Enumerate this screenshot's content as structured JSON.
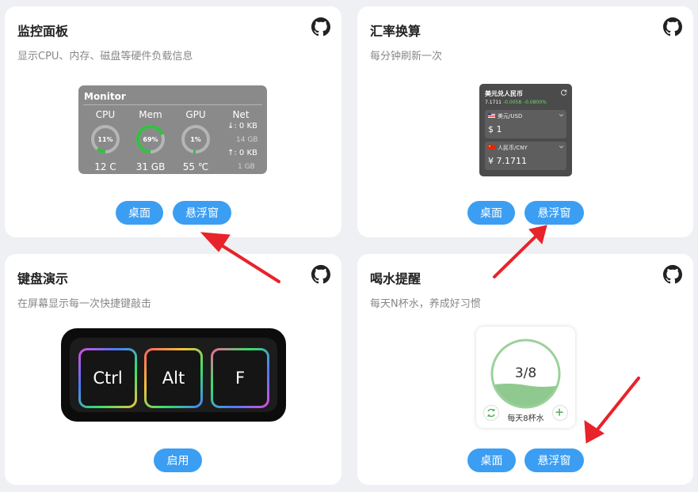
{
  "cards": {
    "monitor": {
      "title": "监控面板",
      "desc": "显示CPU、内存、磁盘等硬件负载信息",
      "widget": {
        "title": "Monitor",
        "cpu_label": "CPU",
        "cpu_pct": "11%",
        "cpu_val": "12 C",
        "cpu_level": 0.11,
        "mem_label": "Mem",
        "mem_pct": "69%",
        "mem_val": "31 GB",
        "mem_level": 0.69,
        "gpu_label": "GPU",
        "gpu_pct": "1%",
        "gpu_val": "55 ℃",
        "gpu_level": 0.01,
        "net_label": "Net",
        "net_down": "↓: 0 KB",
        "net_down_total": "14 GB",
        "net_up": "↑: 0 KB",
        "net_up_total": "1 GB"
      },
      "btn_desktop": "桌面",
      "btn_float": "悬浮窗"
    },
    "exchange": {
      "title": "汇率换算",
      "desc": "每分钟刷新一次",
      "widget": {
        "title": "美元兑人民币",
        "rate": "7.1711",
        "change": "-0.0058",
        "change_pct": "-0.0800%",
        "from_currency": "美元/USD",
        "from_amount": "$ 1",
        "to_currency": "人民币/CNY",
        "to_amount": "¥ 7.1711"
      },
      "btn_desktop": "桌面",
      "btn_float": "悬浮窗"
    },
    "keyboard": {
      "title": "键盘演示",
      "desc": "在屏幕显示每一次快捷键敲击",
      "keys": [
        "Ctrl",
        "Alt",
        "F"
      ],
      "btn_enable": "启用"
    },
    "water": {
      "title": "喝水提醒",
      "desc": "每天N杯水，养成好习惯",
      "widget": {
        "count": "3/8",
        "level": 0.375,
        "label": "每天8杯水"
      },
      "btn_desktop": "桌面",
      "btn_float": "悬浮窗"
    }
  },
  "colors": {
    "accent": "#3b9ef3",
    "arrow": "#e8232a",
    "gauge_green": "#2fc23f",
    "gauge_yellow": "#f0b22a",
    "water_green": "#8fc98f"
  },
  "icons": [
    "github-icon",
    "refresh-icon",
    "chevron-down-icon",
    "us-flag-icon",
    "cn-flag-icon",
    "reset-icon",
    "plus-icon"
  ]
}
